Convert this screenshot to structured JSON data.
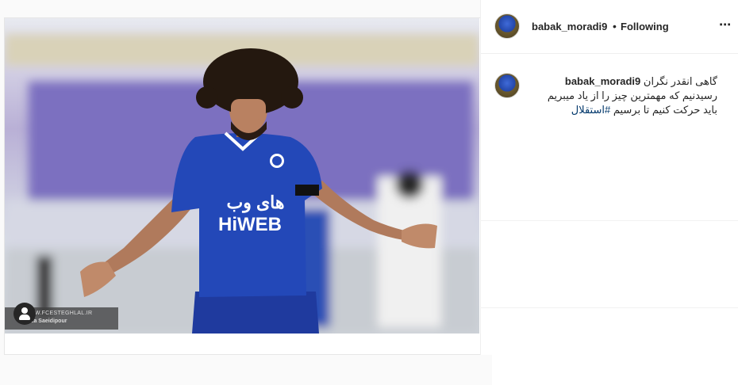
{
  "post": {
    "username": "babak_moradi9",
    "separator": "•",
    "follow_status": "Following",
    "more_icon": "⋯",
    "caption_lines": [
      "گاهی انقدر نگران",
      "رسیدنیم که مهمترین چیز را از یاد میبریم",
      "باید حرکت کنیم تا برسیم"
    ],
    "hashtag": "#استقلال"
  },
  "media": {
    "jersey_text_fa": "های وب",
    "jersey_text_en": "HiWEB",
    "watermark_site": "WWW.FCESTEGHLAL.IR",
    "watermark_credit": "Reza Saeidipour",
    "colors": {
      "jersey": "#2348b8",
      "shorts": "#1f3a9e",
      "stadium_seats": "#6a5fb0"
    }
  },
  "icons": {
    "tag": "user-tag-icon",
    "more": "more-options-icon"
  }
}
